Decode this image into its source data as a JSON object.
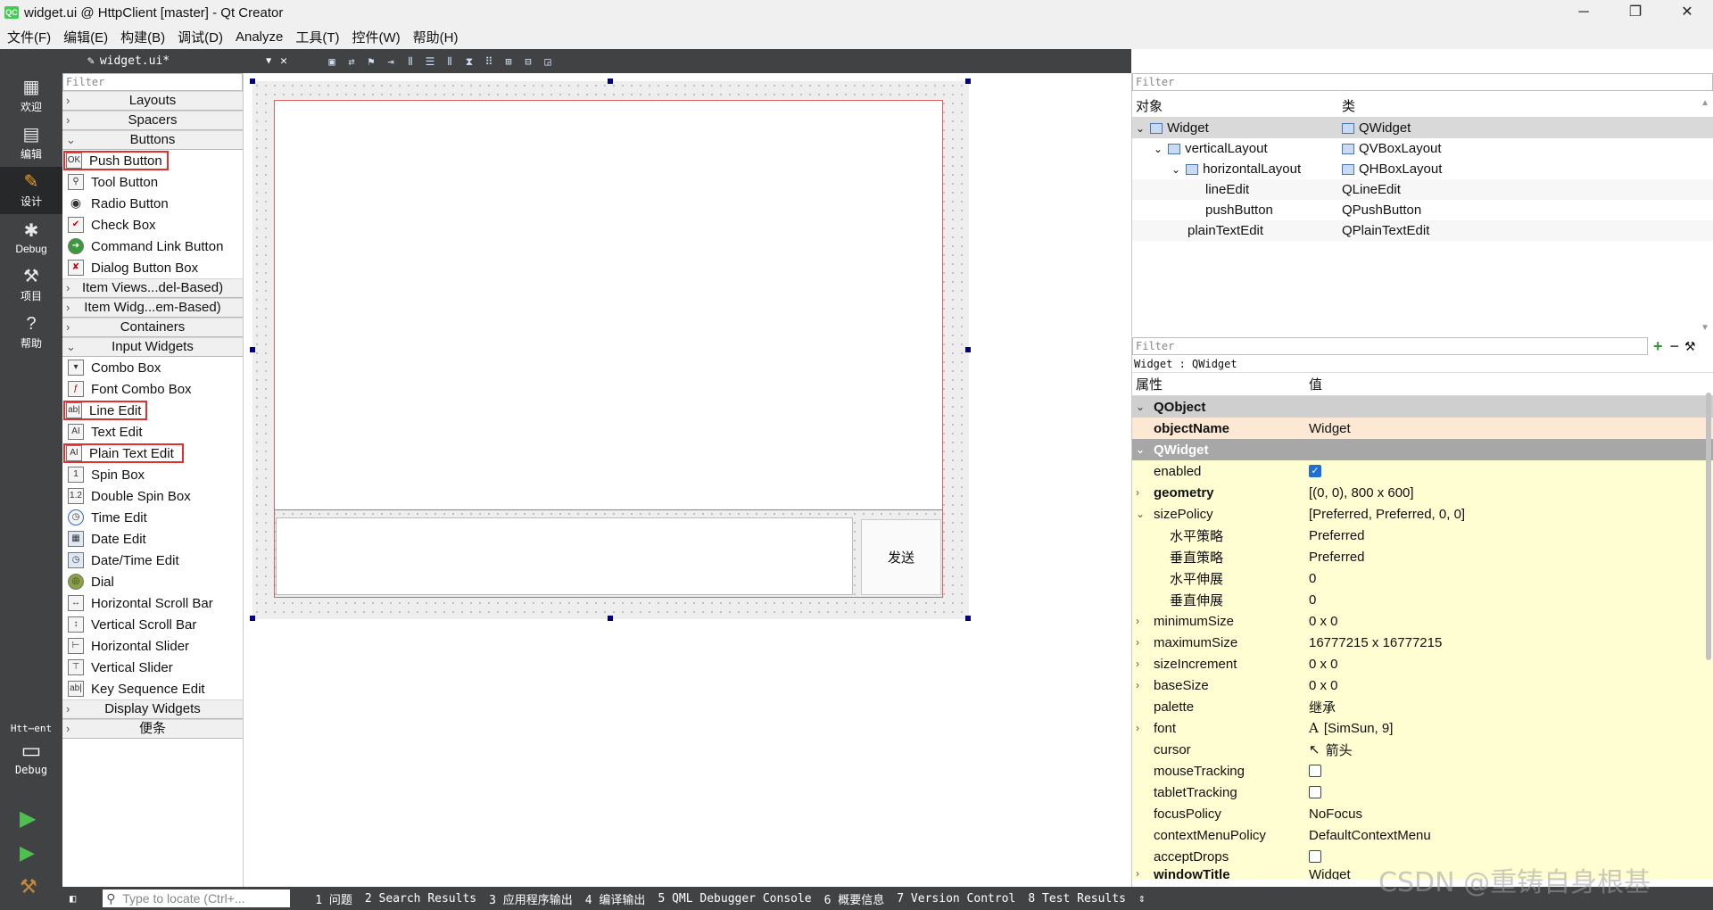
{
  "window": {
    "title": "widget.ui @ HttpClient [master] - Qt Creator",
    "minimize": "─",
    "maximize": "❐",
    "close": "✕"
  },
  "menubar": [
    "文件(F)",
    "编辑(E)",
    "构建(B)",
    "调试(D)",
    "Analyze",
    "工具(T)",
    "控件(W)",
    "帮助(H)"
  ],
  "modes": [
    {
      "label": "欢迎",
      "icon": "grid-icon",
      "glyph": "▦"
    },
    {
      "label": "编辑",
      "icon": "edit-icon",
      "glyph": "▤"
    },
    {
      "label": "设计",
      "icon": "design-icon",
      "glyph": "✎"
    },
    {
      "label": "Debug",
      "icon": "bug-icon",
      "glyph": "✱"
    },
    {
      "label": "项目",
      "icon": "wrench-icon",
      "glyph": "⚒"
    },
    {
      "label": "帮助",
      "icon": "help-icon",
      "glyph": "?"
    }
  ],
  "kit": {
    "project": "Htt⋯ent",
    "config": "Debug"
  },
  "editor": {
    "document": "widget.ui*",
    "close": "✕"
  },
  "widgetbox": {
    "filter": "Filter",
    "categories": {
      "layouts": "Layouts",
      "spacers": "Spacers",
      "buttons": "Buttons",
      "item_views": "Item Views...del-Based)",
      "item_widgets": "Item Widg...em-Based)",
      "containers": "Containers",
      "input_widgets": "Input Widgets",
      "display_widgets": "Display Widgets",
      "scratch": "便条"
    },
    "buttons": [
      "Push Button",
      "Tool Button",
      "Radio Button",
      "Check Box",
      "Command Link Button",
      "Dialog Button Box"
    ],
    "inputs": [
      "Combo Box",
      "Font Combo Box",
      "Line Edit",
      "Text Edit",
      "Plain Text Edit",
      "Spin Box",
      "Double Spin Box",
      "Time Edit",
      "Date Edit",
      "Date/Time Edit",
      "Dial",
      "Horizontal Scroll Bar",
      "Vertical Scroll Bar",
      "Horizontal Slider",
      "Vertical Slider",
      "Key Sequence Edit"
    ]
  },
  "form": {
    "send_button": "发送"
  },
  "object_inspector": {
    "filter": "Filter",
    "col_object": "对象",
    "col_class": "类",
    "rows": [
      {
        "name": "Widget",
        "cls": "QWidget"
      },
      {
        "name": "verticalLayout",
        "cls": "QVBoxLayout"
      },
      {
        "name": "horizontalLayout",
        "cls": "QHBoxLayout"
      },
      {
        "name": "lineEdit",
        "cls": "QLineEdit"
      },
      {
        "name": "pushButton",
        "cls": "QPushButton"
      },
      {
        "name": "plainTextEdit",
        "cls": "QPlainTextEdit"
      }
    ]
  },
  "property_editor": {
    "filter": "Filter",
    "context": "Widget : QWidget",
    "col_prop": "属性",
    "col_value": "值",
    "rows": [
      {
        "name": "QObject",
        "value": ""
      },
      {
        "name": "objectName",
        "value": "Widget"
      },
      {
        "name": "QWidget",
        "value": ""
      },
      {
        "name": "enabled",
        "value": ""
      },
      {
        "name": "geometry",
        "value": "[(0, 0), 800 x 600]"
      },
      {
        "name": "sizePolicy",
        "value": "[Preferred, Preferred, 0, 0]"
      },
      {
        "name": "水平策略",
        "value": "Preferred"
      },
      {
        "name": "垂直策略",
        "value": "Preferred"
      },
      {
        "name": "水平伸展",
        "value": "0"
      },
      {
        "name": "垂直伸展",
        "value": "0"
      },
      {
        "name": "minimumSize",
        "value": "0 x 0"
      },
      {
        "name": "maximumSize",
        "value": "16777215 x 16777215"
      },
      {
        "name": "sizeIncrement",
        "value": "0 x 0"
      },
      {
        "name": "baseSize",
        "value": "0 x 0"
      },
      {
        "name": "palette",
        "value": "继承"
      },
      {
        "name": "font",
        "value": "[SimSun, 9]"
      },
      {
        "name": "cursor",
        "value": "箭头"
      },
      {
        "name": "mouseTracking",
        "value": ""
      },
      {
        "name": "tabletTracking",
        "value": ""
      },
      {
        "name": "focusPolicy",
        "value": "NoFocus"
      },
      {
        "name": "contextMenuPolicy",
        "value": "DefaultContextMenu"
      },
      {
        "name": "acceptDrops",
        "value": ""
      },
      {
        "name": "windowTitle",
        "value": "Widget"
      }
    ]
  },
  "bottombar": {
    "locate_placeholder": "Type to locate (Ctrl+...",
    "tabs": [
      "1 问题",
      "2 Search Results",
      "3 应用程序输出",
      "4 编译输出",
      "5 QML Debugger Console",
      "6 概要信息",
      "7 Version Control",
      "8 Test Results"
    ]
  },
  "watermark": "CSDN @重铸自身根基",
  "colors": {
    "accent": "#f0a030",
    "selection_outline": "#e03030",
    "dark_bar": "#404244",
    "property_yellow": "#fffdd2"
  }
}
